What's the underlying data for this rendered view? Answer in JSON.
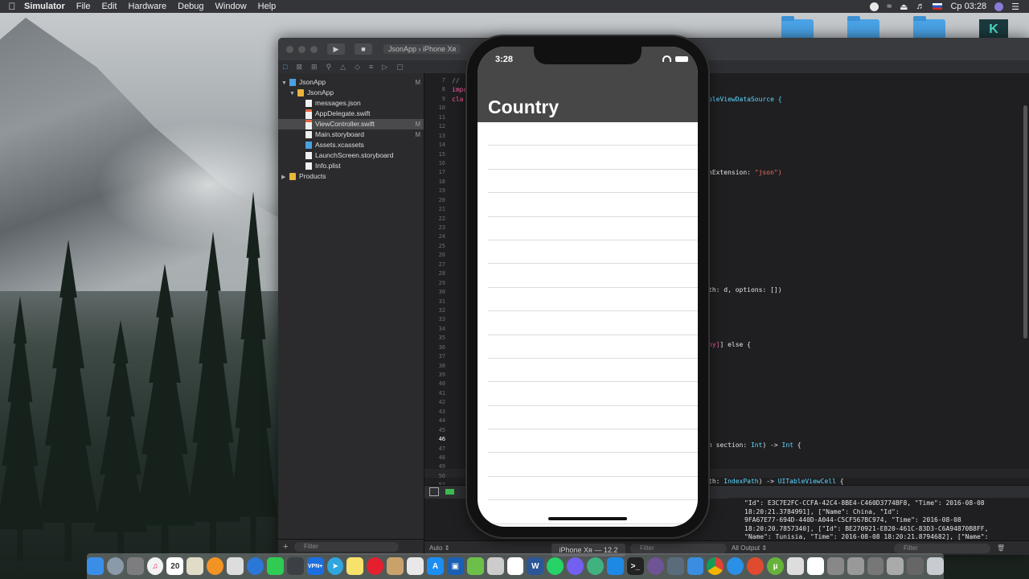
{
  "menubar": {
    "app": "Simulator",
    "items": [
      "File",
      "Edit",
      "Hardware",
      "Debug",
      "Window",
      "Help"
    ],
    "clock": "Ср 03:28"
  },
  "xcode": {
    "scheme": "JsonApp",
    "destination": "iPhone Xʀ",
    "navigator": {
      "rows": [
        {
          "label": "JsonApp",
          "indent": 0,
          "icon": "project-icon",
          "badge": "M"
        },
        {
          "label": "JsonApp",
          "indent": 1,
          "icon": "folder-icon",
          "badge": ""
        },
        {
          "label": "messages.json",
          "indent": 2,
          "icon": "file-icon",
          "badge": ""
        },
        {
          "label": "AppDelegate.swift",
          "indent": 2,
          "icon": "swift-file-icon",
          "badge": ""
        },
        {
          "label": "ViewController.swift",
          "indent": 2,
          "icon": "swift-file-icon",
          "badge": "M",
          "selected": true
        },
        {
          "label": "Main.storyboard",
          "indent": 2,
          "icon": "storyboard-icon",
          "badge": "M"
        },
        {
          "label": "Assets.xcassets",
          "indent": 2,
          "icon": "assets-icon",
          "badge": ""
        },
        {
          "label": "LaunchScreen.storyboard",
          "indent": 2,
          "icon": "storyboard-icon",
          "badge": ""
        },
        {
          "label": "Info.plist",
          "indent": 2,
          "icon": "plist-icon",
          "badge": ""
        },
        {
          "label": "Products",
          "indent": 0,
          "icon": "folder-icon",
          "badge": ""
        }
      ],
      "filter_placeholder": "Filter"
    },
    "line_numbers": [
      "7",
      "8",
      "9",
      "10",
      "11",
      "12",
      "13",
      "14",
      "15",
      "16",
      "17",
      "18",
      "19",
      "20",
      "21",
      "22",
      "23",
      "24",
      "25",
      "26",
      "27",
      "28",
      "29",
      "30",
      "31",
      "32",
      "33",
      "34",
      "35",
      "36",
      "37",
      "38",
      "39",
      "40",
      "41",
      "42",
      "43",
      "44",
      "45",
      "46",
      "47",
      "48",
      "49",
      "50",
      "51"
    ],
    "current_line": "46",
    "code_fragments": {
      "l7": "//",
      "l8": "impo",
      "l9a": "cla",
      "l9b": "bleViewDataSource {",
      "l17a": "hExtension: ",
      "l17b": "\"json\")",
      "l30": "th: d, options: [])",
      "l36a": "ny]",
      "l36b": "] else {",
      "l47a": "n section: ",
      "l47b": "Int",
      "l47c": ") -> ",
      "l47d": "Int",
      "l47e": " {",
      "l51a": "th: ",
      "l51b": "IndexPath",
      "l51c": ") -> ",
      "l51d": "UITableViewCell",
      "l51e": " {"
    },
    "console_lines": [
      "\"Id\": E3C7E2FC-CCFA-42C4-8BE4-C460D3774BF8, \"Time\": 2016-08-08",
      "18:20:21.3784991], [\"Name\": China, \"Id\":",
      "9FA67E77-694D-440D-A044-C5CF567BC974, \"Time\": 2016-08-08",
      "18:20:20.7857340], [\"Id\": BE270921-E820-461C-83D3-C6A94870B8FF,",
      "\"Name\": Tunisia, \"Time\": 2016-08-08 18:20:21.8794682], [\"Name\":"
    ],
    "bottom": {
      "auto_label": "Auto",
      "filter_placeholder": "Filter",
      "output_label": "All Output"
    }
  },
  "simulator": {
    "time": "3:28",
    "title": "Country",
    "cell_count": 17,
    "device_label": "iPhone Xʀ — 12.2"
  }
}
